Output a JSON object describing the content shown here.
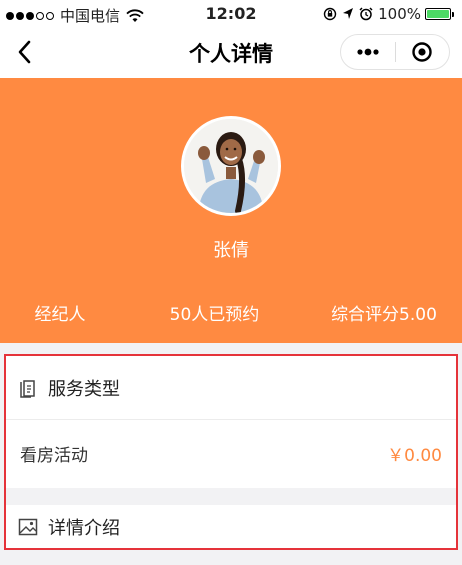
{
  "status_bar": {
    "carrier": "中国电信",
    "time": "12:02",
    "battery": "100%"
  },
  "nav": {
    "title": "个人详情",
    "back_icon": "back-arrow-icon",
    "more_icon": "more-dots-icon",
    "close_icon": "target-close-icon"
  },
  "profile": {
    "name": "张倩",
    "role": "经纪人",
    "booked": "50人已预约",
    "rating": "综合评分5.00",
    "header_color": "#ff8a41"
  },
  "sections": {
    "service": {
      "title": "服务类型",
      "icon": "document-icon",
      "items": [
        {
          "name": "看房活动",
          "price": "￥0.00"
        }
      ]
    },
    "detail": {
      "title": "详情介绍",
      "icon": "image-icon"
    }
  },
  "colors": {
    "accent": "#ff8a41",
    "highlight_border": "#e5333a"
  }
}
